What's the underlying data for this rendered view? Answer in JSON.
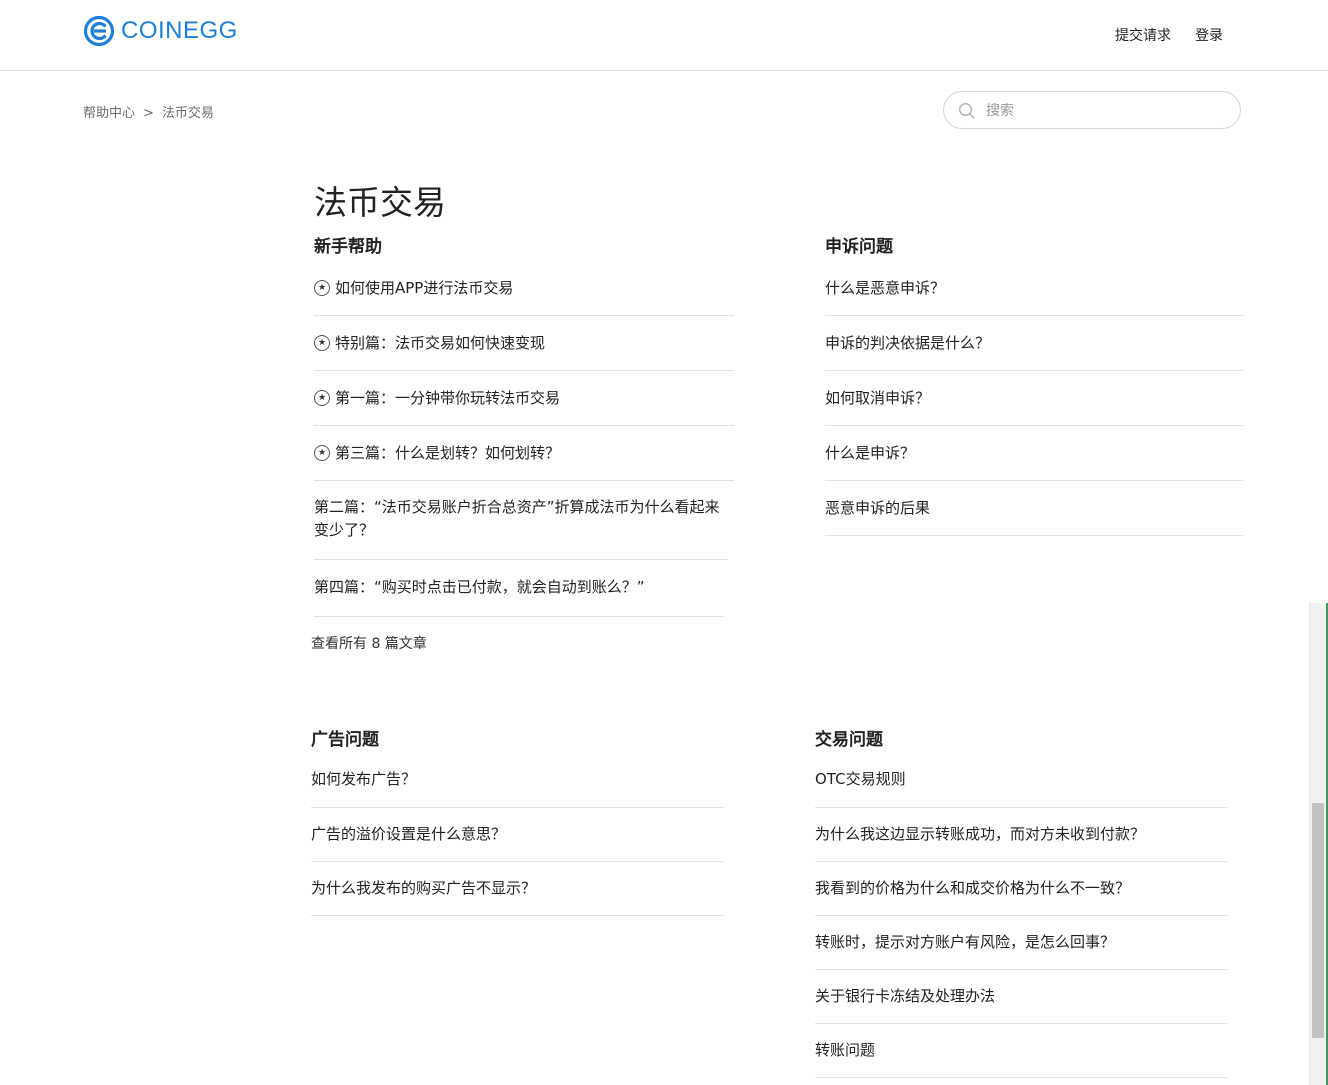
{
  "brand": {
    "name": "COINEGG",
    "color": "#1f7fd6"
  },
  "nav": {
    "submit_request": "提交请求",
    "login": "登录"
  },
  "breadcrumb": {
    "home": "帮助中心",
    "separator": ">",
    "current": "法币交易"
  },
  "search": {
    "placeholder": "搜索",
    "icon": "search-icon"
  },
  "page_title": "法币交易",
  "sections": {
    "newbie": {
      "title": "新手帮助",
      "articles": [
        {
          "title": "如何使用APP进行法币交易",
          "promoted": true
        },
        {
          "title": "特别篇：法币交易如何快速变现",
          "promoted": true
        },
        {
          "title": "第一篇：一分钟带你玩转法币交易",
          "promoted": true
        },
        {
          "title": "第三篇：什么是划转？如何划转？",
          "promoted": true
        },
        {
          "title": "第二篇：“法币交易账户折合总资产”折算成法币为什么看起来变少了？",
          "promoted": false
        },
        {
          "title": "第四篇：“购买时点击已付款，就会自动到账么？”",
          "promoted": false
        }
      ],
      "see_all": "查看所有 8 篇文章"
    },
    "appeal": {
      "title": "申诉问题",
      "articles": [
        {
          "title": "什么是恶意申诉？"
        },
        {
          "title": "申诉的判决依据是什么？"
        },
        {
          "title": "如何取消申诉？"
        },
        {
          "title": "什么是申诉？"
        },
        {
          "title": "恶意申诉的后果"
        }
      ]
    },
    "ads": {
      "title": "广告问题",
      "articles": [
        {
          "title": "如何发布广告？"
        },
        {
          "title": "广告的溢价设置是什么意思？"
        },
        {
          "title": "为什么我发布的购买广告不显示？"
        }
      ]
    },
    "trade": {
      "title": "交易问题",
      "articles": [
        {
          "title": "OTC交易规则"
        },
        {
          "title": "为什么我这边显示转账成功，而对方未收到付款？"
        },
        {
          "title": "我看到的价格为什么和成交价格为什么不一致？"
        },
        {
          "title": "转账时，提示对方账户有风险，是怎么回事？"
        },
        {
          "title": "关于银行卡冻结及处理办法"
        },
        {
          "title": "转账问题"
        }
      ]
    }
  }
}
